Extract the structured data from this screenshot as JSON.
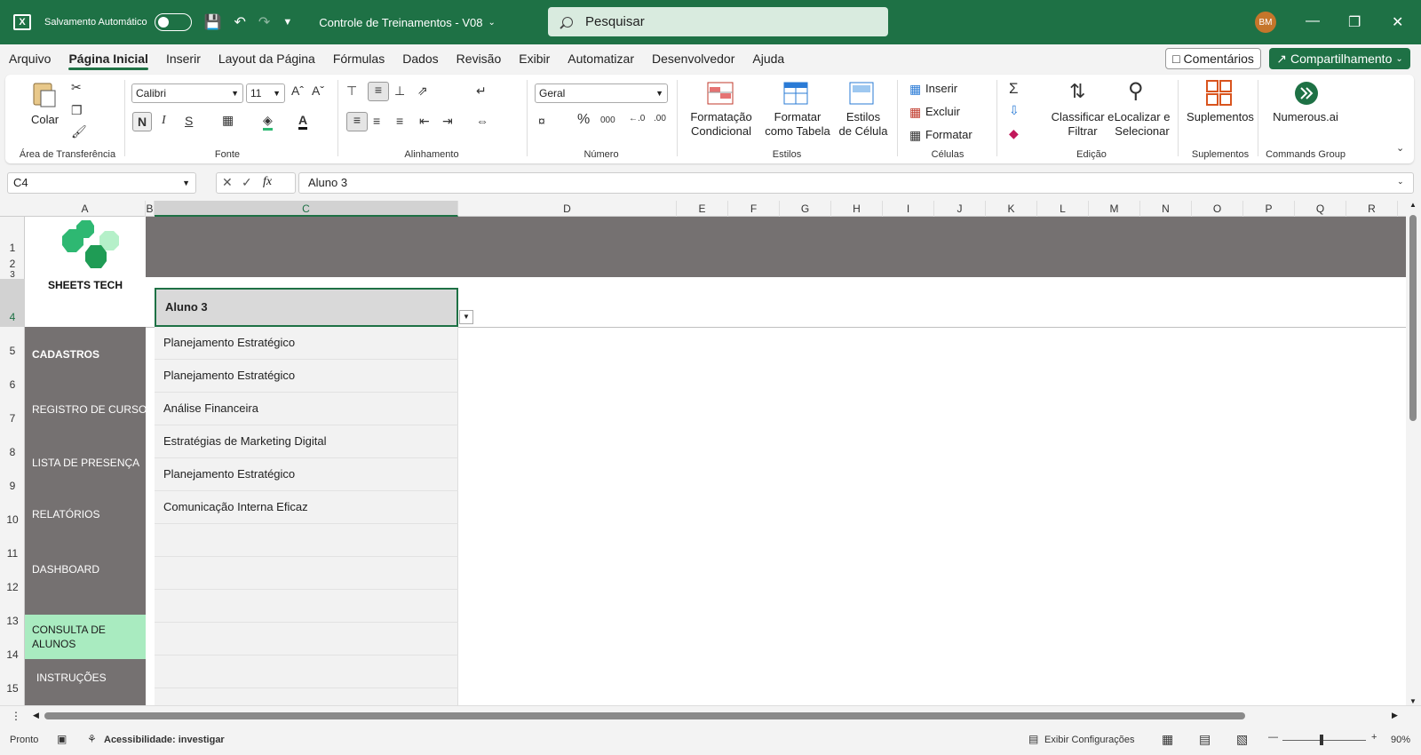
{
  "titlebar": {
    "autosave_label": "Salvamento Automático",
    "doc_title": "Controle de Treinamentos  -  V08",
    "search_placeholder": "Pesquisar",
    "avatar_initials": "BM"
  },
  "menu": {
    "items": [
      "Arquivo",
      "Página Inicial",
      "Inserir",
      "Layout da Página",
      "Fórmulas",
      "Dados",
      "Revisão",
      "Exibir",
      "Automatizar",
      "Desenvolvedor",
      "Ajuda"
    ],
    "active": "Página Inicial",
    "comments_label": "Comentários",
    "share_label": "Compartilhamento"
  },
  "ribbon": {
    "paste_label": "Colar",
    "clipboard_group": "Área de Transferência",
    "font_name": "Calibri",
    "font_size": "11",
    "bold_label": "N",
    "italic_label": "I",
    "underline_label": "S",
    "font_group": "Fonte",
    "alignment_group": "Alinhamento",
    "number_format": "Geral",
    "number_group": "Número",
    "cond_format_label": "Formatação Condicional",
    "format_table_label": "Formatar como Tabela",
    "cell_styles_label": "Estilos de Célula",
    "styles_group": "Estilos",
    "insert_label": "Inserir",
    "delete_label": "Excluir",
    "format_label": "Formatar",
    "cells_group": "Células",
    "sort_filter_label": "Classificar e Filtrar",
    "find_select_label": "Localizar e Selecionar",
    "editing_group": "Edição",
    "addins_label": "Suplementos",
    "addins_group": "Suplementos",
    "numerous_label": "Numerous.ai",
    "commands_group": "Commands Group"
  },
  "formula_bar": {
    "cell_ref": "C4",
    "fx_label": "fx",
    "content": "Aluno 3"
  },
  "columns": [
    "A",
    "B",
    "C",
    "D",
    "E",
    "F",
    "G",
    "H",
    "I",
    "J",
    "K",
    "L",
    "M",
    "N",
    "O",
    "P",
    "Q",
    "R"
  ],
  "rows": [
    "1",
    "2",
    "3",
    "4",
    "5",
    "6",
    "7",
    "8",
    "9",
    "10",
    "11",
    "12",
    "13",
    "14",
    "15"
  ],
  "sheet": {
    "logo_text": "SHEETS TECH",
    "nav": [
      "CADASTROS",
      "REGISTRO DE CURSOS",
      "LISTA DE PRESENÇA",
      "RELATÓRIOS",
      "DASHBOARD",
      "CONSULTA DE ALUNOS",
      "INSTRUÇÕES"
    ],
    "active_nav": "CONSULTA DE ALUNOS",
    "header_cell": "Aluno 3",
    "courses": [
      "Planejamento Estratégico",
      "Planejamento Estratégico",
      "Análise Financeira",
      "Estratégias de Marketing Digital",
      "Planejamento Estratégico",
      "Comunicação Interna Eficaz"
    ]
  },
  "status": {
    "ready": "Pronto",
    "accessibility": "Acessibilidade: investigar",
    "display_settings": "Exibir Configurações",
    "zoom": "90%"
  },
  "colors": {
    "brand_green": "#1e7145",
    "sidebar_gray": "#757171",
    "active_nav": "#a9ebc0"
  }
}
